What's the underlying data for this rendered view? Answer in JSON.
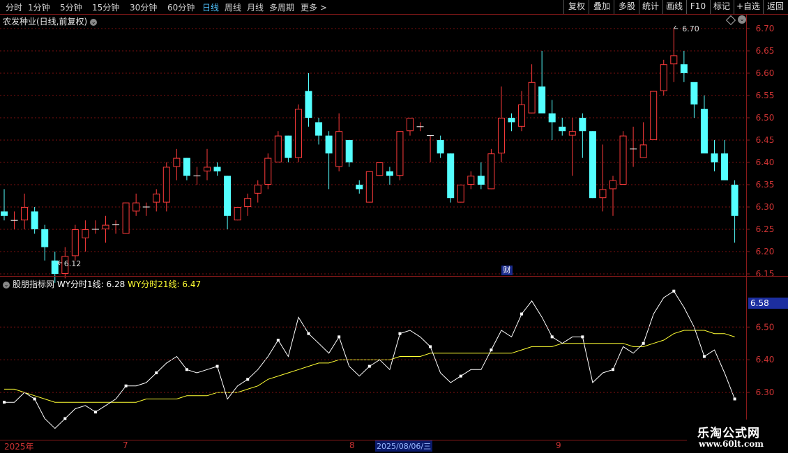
{
  "toolbar": {
    "periods": [
      {
        "label": "分时",
        "active": false
      },
      {
        "label": "1分钟",
        "active": false
      },
      {
        "label": "5分钟",
        "active": false
      },
      {
        "label": "15分钟",
        "active": false
      },
      {
        "label": "30分钟",
        "active": false
      },
      {
        "label": "60分钟",
        "active": false
      },
      {
        "label": "日线",
        "active": true
      },
      {
        "label": "周线",
        "active": false
      },
      {
        "label": "月线",
        "active": false
      },
      {
        "label": "多周期",
        "active": false
      },
      {
        "label": "更多 >",
        "active": false
      }
    ],
    "buttons": [
      "复权",
      "叠加",
      "多股",
      "统计",
      "画线",
      "F10",
      "标记",
      "+自选",
      "返回"
    ]
  },
  "stock_title": "农发种业(日线,前复权)",
  "indicator": {
    "name": "股朋指标网",
    "line1": "WY分时1线: 6.28",
    "line2": "WY分时21线: 6.47"
  },
  "current_price_label": "6.58",
  "finance_marker": "财",
  "high_label": "6.70",
  "low_label": "6.12",
  "price_axis": [
    "6.70",
    "6.65",
    "6.60",
    "6.55",
    "6.50",
    "6.45",
    "6.40",
    "6.35",
    "6.30",
    "6.25",
    "6.20",
    "6.15"
  ],
  "indicator_axis": [
    "6.50",
    "6.40",
    "6.30"
  ],
  "date_labels": {
    "year": "2025年",
    "m7": "7",
    "m8": "8",
    "selected": "2025/08/06/三",
    "m9": "9"
  },
  "watermark": {
    "title": "乐淘公式网",
    "url": "www.60lt.com"
  },
  "colors": {
    "up": "#ff3b3b",
    "down": "#54ffff",
    "line1": "#ffffff",
    "line21": "#ffff33",
    "grid": "#7a1010"
  },
  "chart_data": [
    {
      "type": "candlestick",
      "title": "农发种业(日线,前复权)",
      "ylim": [
        6.12,
        6.72
      ],
      "ohlc": [
        [
          6.29,
          6.34,
          6.27,
          6.28
        ],
        [
          6.27,
          6.29,
          6.25,
          6.27
        ],
        [
          6.27,
          6.33,
          6.25,
          6.3
        ],
        [
          6.29,
          6.3,
          6.24,
          6.25
        ],
        [
          6.25,
          6.26,
          6.18,
          6.21
        ],
        [
          6.18,
          6.2,
          6.13,
          6.15
        ],
        [
          6.15,
          6.21,
          6.14,
          6.19
        ],
        [
          6.19,
          6.26,
          6.18,
          6.25
        ],
        [
          6.23,
          6.27,
          6.2,
          6.25
        ],
        [
          6.25,
          6.27,
          6.24,
          6.25
        ],
        [
          6.25,
          6.28,
          6.22,
          6.26
        ],
        [
          6.26,
          6.27,
          6.24,
          6.26
        ],
        [
          6.24,
          6.31,
          6.24,
          6.31
        ],
        [
          6.29,
          6.33,
          6.28,
          6.31
        ],
        [
          6.3,
          6.31,
          6.28,
          6.3
        ],
        [
          6.31,
          6.34,
          6.29,
          6.33
        ],
        [
          6.31,
          6.4,
          6.29,
          6.39
        ],
        [
          6.39,
          6.43,
          6.36,
          6.41
        ],
        [
          6.41,
          6.41,
          6.36,
          6.37
        ],
        [
          6.37,
          6.39,
          6.35,
          6.37
        ],
        [
          6.38,
          6.43,
          6.36,
          6.39
        ],
        [
          6.39,
          6.4,
          6.37,
          6.38
        ],
        [
          6.37,
          6.37,
          6.25,
          6.28
        ],
        [
          6.27,
          6.3,
          6.27,
          6.3
        ],
        [
          6.3,
          6.33,
          6.28,
          6.32
        ],
        [
          6.33,
          6.36,
          6.31,
          6.35
        ],
        [
          6.35,
          6.42,
          6.34,
          6.41
        ],
        [
          6.4,
          6.47,
          6.4,
          6.46
        ],
        [
          6.46,
          6.46,
          6.4,
          6.41
        ],
        [
          6.41,
          6.53,
          6.4,
          6.52
        ],
        [
          6.56,
          6.6,
          6.48,
          6.5
        ],
        [
          6.49,
          6.5,
          6.44,
          6.46
        ],
        [
          6.46,
          6.47,
          6.34,
          6.42
        ],
        [
          6.39,
          6.51,
          6.38,
          6.47
        ],
        [
          6.45,
          6.45,
          6.39,
          6.4
        ],
        [
          6.35,
          6.36,
          6.33,
          6.34
        ],
        [
          6.31,
          6.38,
          6.31,
          6.38
        ],
        [
          6.37,
          6.4,
          6.37,
          6.4
        ],
        [
          6.38,
          6.39,
          6.35,
          6.37
        ],
        [
          6.37,
          6.47,
          6.36,
          6.47
        ],
        [
          6.47,
          6.5,
          6.46,
          6.5
        ],
        [
          6.48,
          6.49,
          6.47,
          6.48
        ],
        [
          6.46,
          6.46,
          6.4,
          6.46
        ],
        [
          6.45,
          6.46,
          6.41,
          6.42
        ],
        [
          6.42,
          6.42,
          6.31,
          6.32
        ],
        [
          6.31,
          6.35,
          6.31,
          6.35
        ],
        [
          6.35,
          6.38,
          6.34,
          6.37
        ],
        [
          6.37,
          6.4,
          6.34,
          6.35
        ],
        [
          6.34,
          6.43,
          6.34,
          6.42
        ],
        [
          6.42,
          6.57,
          6.4,
          6.5
        ],
        [
          6.5,
          6.51,
          6.47,
          6.49
        ],
        [
          6.48,
          6.56,
          6.47,
          6.53
        ],
        [
          6.51,
          6.62,
          6.51,
          6.58
        ],
        [
          6.57,
          6.65,
          6.52,
          6.51
        ],
        [
          6.51,
          6.54,
          6.45,
          6.49
        ],
        [
          6.48,
          6.5,
          6.46,
          6.47
        ],
        [
          6.46,
          6.5,
          6.37,
          6.47
        ],
        [
          6.5,
          6.51,
          6.41,
          6.47
        ],
        [
          6.47,
          6.47,
          6.32,
          6.32
        ],
        [
          6.32,
          6.44,
          6.29,
          6.34
        ],
        [
          6.34,
          6.37,
          6.28,
          6.36
        ],
        [
          6.35,
          6.47,
          6.35,
          6.46
        ],
        [
          6.43,
          6.48,
          6.39,
          6.43
        ],
        [
          6.41,
          6.49,
          6.41,
          6.44
        ],
        [
          6.45,
          6.56,
          6.45,
          6.56
        ],
        [
          6.56,
          6.63,
          6.55,
          6.62
        ],
        [
          6.62,
          6.7,
          6.58,
          6.64
        ],
        [
          6.62,
          6.65,
          6.58,
          6.6
        ],
        [
          6.58,
          6.57,
          6.5,
          6.53
        ],
        [
          6.52,
          6.55,
          6.46,
          6.42
        ],
        [
          6.42,
          6.45,
          6.38,
          6.4
        ],
        [
          6.42,
          6.45,
          6.39,
          6.36
        ],
        [
          6.35,
          6.36,
          6.22,
          6.28
        ]
      ]
    },
    {
      "type": "line",
      "series": [
        {
          "name": "WY分时1线",
          "values": [
            6.27,
            6.27,
            6.3,
            6.28,
            6.22,
            6.19,
            6.22,
            6.25,
            6.26,
            6.24,
            6.26,
            6.28,
            6.32,
            6.32,
            6.33,
            6.36,
            6.39,
            6.41,
            6.37,
            6.36,
            6.37,
            6.38,
            6.28,
            6.32,
            6.34,
            6.37,
            6.41,
            6.46,
            6.41,
            6.53,
            6.48,
            6.45,
            6.42,
            6.47,
            6.38,
            6.35,
            6.38,
            6.4,
            6.37,
            6.48,
            6.49,
            6.47,
            6.44,
            6.36,
            6.33,
            6.35,
            6.37,
            6.37,
            6.43,
            6.49,
            6.47,
            6.54,
            6.58,
            6.53,
            6.47,
            6.45,
            6.47,
            6.47,
            6.33,
            6.36,
            6.37,
            6.44,
            6.42,
            6.45,
            6.54,
            6.59,
            6.61,
            6.56,
            6.5,
            6.41,
            6.43,
            6.36,
            6.28
          ]
        },
        {
          "name": "WY分时21线",
          "values": [
            6.31,
            6.31,
            6.3,
            6.29,
            6.28,
            6.27,
            6.27,
            6.27,
            6.27,
            6.27,
            6.27,
            6.27,
            6.27,
            6.27,
            6.28,
            6.28,
            6.28,
            6.28,
            6.29,
            6.29,
            6.29,
            6.3,
            6.3,
            6.3,
            6.31,
            6.32,
            6.34,
            6.35,
            6.36,
            6.37,
            6.38,
            6.39,
            6.39,
            6.4,
            6.4,
            6.4,
            6.4,
            6.4,
            6.4,
            6.41,
            6.41,
            6.41,
            6.42,
            6.42,
            6.42,
            6.42,
            6.42,
            6.42,
            6.42,
            6.42,
            6.42,
            6.43,
            6.44,
            6.44,
            6.44,
            6.45,
            6.45,
            6.45,
            6.45,
            6.45,
            6.45,
            6.45,
            6.44,
            6.44,
            6.45,
            6.46,
            6.48,
            6.49,
            6.49,
            6.49,
            6.48,
            6.48,
            6.47
          ]
        }
      ]
    }
  ]
}
